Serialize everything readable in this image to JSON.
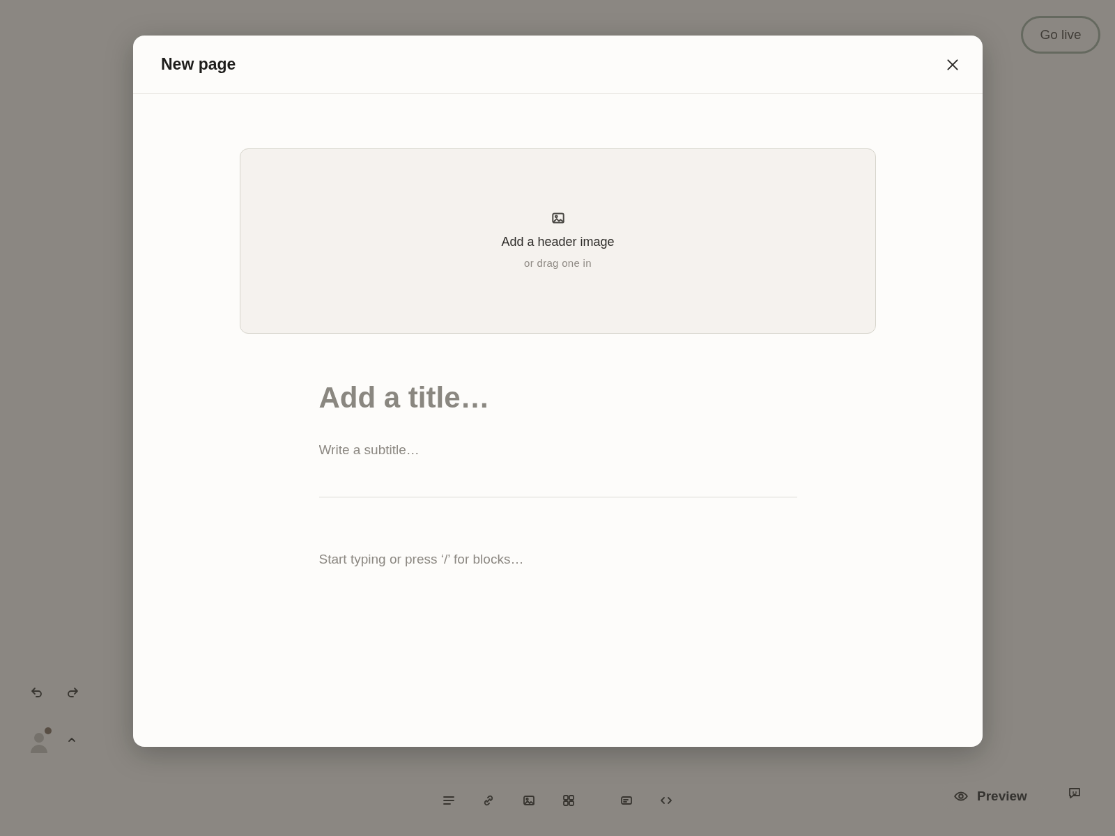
{
  "editor": {
    "go_live_button": "Go live",
    "preview_button": "Preview"
  },
  "modal": {
    "title": "New page",
    "header_image": {
      "label": "Add a header image",
      "hint": "or drag one in"
    },
    "title_field": {
      "placeholder": "Add a title…"
    },
    "subtitle_field": {
      "placeholder": "Write a subtitle…"
    },
    "body_field": {
      "placeholder": "Start typing or press ‘/’ for blocks…"
    }
  }
}
